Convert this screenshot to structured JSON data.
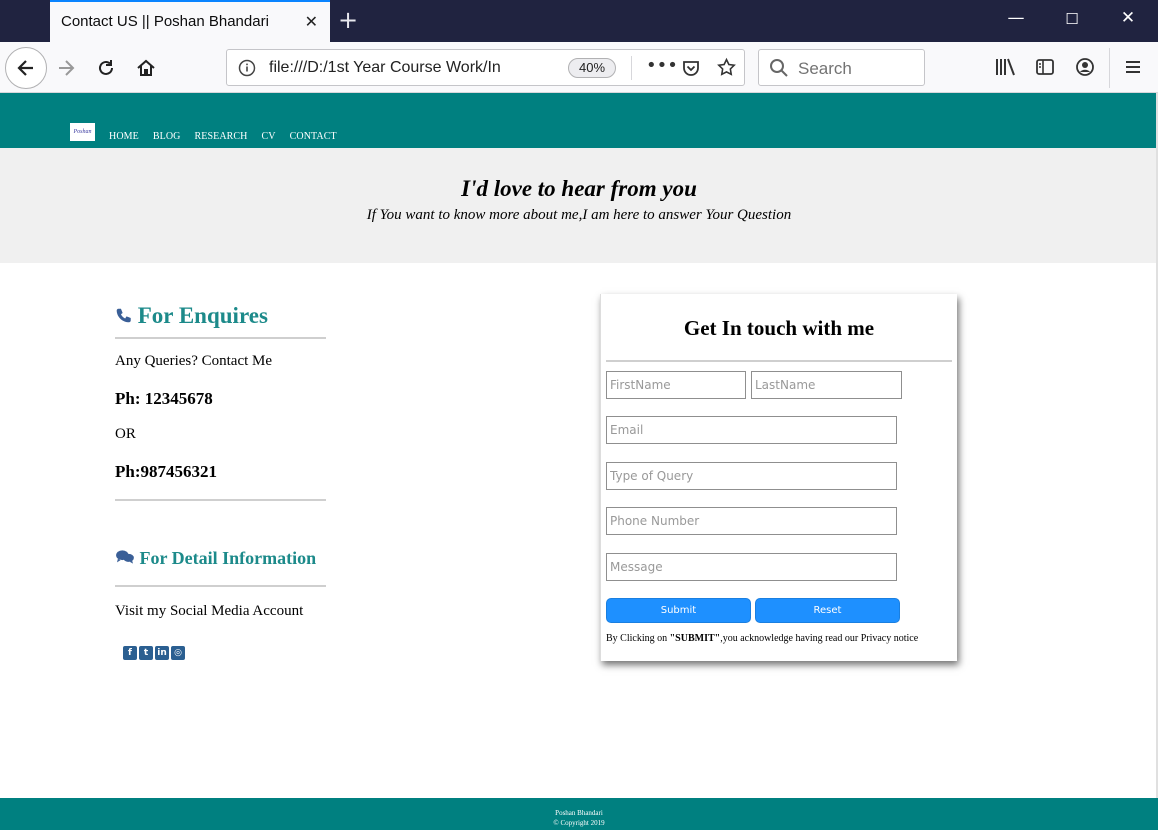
{
  "browser": {
    "tab_title": "Contact US || Poshan Bhandari",
    "url": "file:///D:/1st Year Course Work/In",
    "zoom": "40%",
    "search_placeholder": "Search"
  },
  "site": {
    "logo_text": "Poshan",
    "nav": [
      "HOME",
      "BLOG",
      "RESEARCH",
      "CV",
      "CONTACT"
    ]
  },
  "hero": {
    "title": "I'd love to hear from you",
    "subtitle": "If You want to know more about me,I am here to answer Your Question"
  },
  "enquiries": {
    "title": "For Enquires",
    "lead": "Any Queries? Contact Me",
    "phone1": "Ph: 12345678",
    "or": "OR",
    "phone2": "Ph:987456321"
  },
  "detail": {
    "title": "For Detail Information",
    "social_text": "Visit my Social Media Account"
  },
  "form": {
    "title": "Get In touch with me",
    "firstname_placeholder": "FirstName",
    "lastname_placeholder": "LastName",
    "email_placeholder": "Email",
    "query_placeholder": "Type of Query",
    "phone_placeholder": "Phone Number",
    "message_placeholder": "Message",
    "submit_label": "Submit",
    "reset_label": "Reset",
    "notice_pre": "By Clicking on ",
    "notice_bold": "\"SUBMIT\"",
    "notice_post": ",you acknowledge having read our Privacy notice"
  },
  "footer": {
    "name": "Poshan Bhandari",
    "copyright": "© Copyright 2019"
  },
  "colors": {
    "teal": "#008080",
    "accent_blue": "#1e90ff",
    "heading_teal": "#1c8a8a"
  }
}
